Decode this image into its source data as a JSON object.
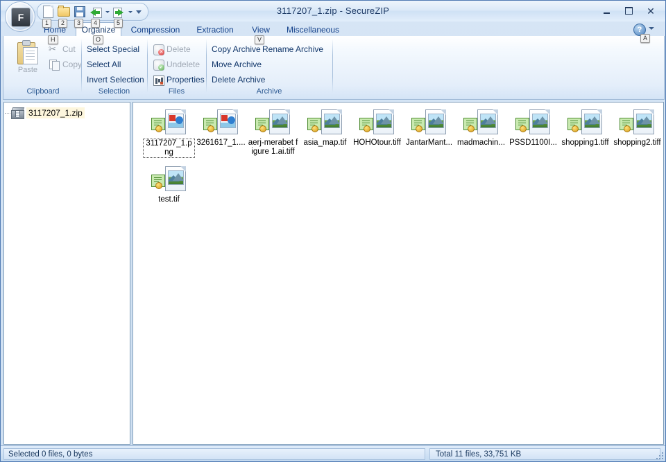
{
  "window": {
    "title": "3117207_1.zip - SecureZIP",
    "minimize_label": "Minimize",
    "maximize_label": "Maximize",
    "close_label": "Close"
  },
  "app_button": {
    "label": "F"
  },
  "quick_access": {
    "items": [
      {
        "name": "new-archive",
        "icon": "new-document-icon",
        "keytip": "1"
      },
      {
        "name": "open-archive",
        "icon": "open-folder-icon",
        "keytip": "2"
      },
      {
        "name": "save-archive",
        "icon": "save-icon",
        "keytip": "3"
      },
      {
        "name": "extract-files",
        "icon": "extract-arrow-icon",
        "keytip": "4"
      },
      {
        "name": "add-files",
        "icon": "add-arrow-icon",
        "keytip": "5"
      }
    ],
    "customize_label": "Customize Quick Access Toolbar"
  },
  "tabs": [
    {
      "label": "Home",
      "keytip": "H",
      "active": false
    },
    {
      "label": "Organize",
      "keytip": "O",
      "active": true
    },
    {
      "label": "Compression",
      "keytip": "",
      "active": false
    },
    {
      "label": "Extraction",
      "keytip": "",
      "active": false
    },
    {
      "label": "View",
      "keytip": "V",
      "active": false
    },
    {
      "label": "Miscellaneous",
      "keytip": "",
      "active": false
    }
  ],
  "help": {
    "glyph": "?",
    "keytip": "A"
  },
  "ribbon": {
    "groups": [
      {
        "name": "clipboard",
        "label": "Clipboard",
        "big_button": {
          "label": "Paste",
          "enabled": false
        },
        "commands": [
          {
            "label": "Cut",
            "enabled": false,
            "icon": "scissors-icon"
          },
          {
            "label": "Copy",
            "enabled": false,
            "icon": "copy-icon"
          }
        ]
      },
      {
        "name": "selection",
        "label": "Selection",
        "commands": [
          {
            "label": "Select Special",
            "enabled": true,
            "icon": ""
          },
          {
            "label": "Select All",
            "enabled": true,
            "icon": ""
          },
          {
            "label": "Invert Selection",
            "enabled": true,
            "icon": ""
          }
        ]
      },
      {
        "name": "files",
        "label": "Files",
        "commands": [
          {
            "label": "Delete",
            "enabled": false,
            "icon": "delete-icon"
          },
          {
            "label": "Undelete",
            "enabled": false,
            "icon": "undelete-icon"
          },
          {
            "label": "Properties",
            "enabled": true,
            "icon": "properties-icon"
          }
        ]
      },
      {
        "name": "archive",
        "label": "Archive",
        "commands": [
          {
            "label": "Copy Archive",
            "enabled": true,
            "icon": ""
          },
          {
            "label": "Rename Archive",
            "enabled": true,
            "icon": ""
          },
          {
            "label": "Move Archive",
            "enabled": true,
            "icon": ""
          },
          {
            "label": "Delete Archive",
            "enabled": true,
            "icon": ""
          }
        ]
      }
    ]
  },
  "tree": {
    "root": {
      "label": "3117207_1.zip",
      "icon": "archive-package-icon",
      "selected": true
    }
  },
  "files": [
    {
      "label": "3117207_1.png",
      "kind": "png",
      "focused": true
    },
    {
      "label": "3261617_1....",
      "kind": "png",
      "focused": false
    },
    {
      "label": "aerj-merabet figure 1.ai.tiff",
      "kind": "tiff",
      "focused": false
    },
    {
      "label": "asia_map.tif",
      "kind": "tiff",
      "focused": false
    },
    {
      "label": "HOHOtour.tiff",
      "kind": "tiff",
      "focused": false
    },
    {
      "label": "JantarMant...",
      "kind": "tiff",
      "focused": false
    },
    {
      "label": "madmachin...",
      "kind": "tiff",
      "focused": false
    },
    {
      "label": "PSSD1100I...",
      "kind": "tiff",
      "focused": false
    },
    {
      "label": "shopping1.tiff",
      "kind": "tiff",
      "focused": false
    },
    {
      "label": "shopping2.tiff",
      "kind": "tiff",
      "focused": false
    },
    {
      "label": "test.tif",
      "kind": "tiff",
      "focused": false
    }
  ],
  "status": {
    "left": "Selected 0 files, 0 bytes",
    "right": "Total 11 files, 33,751 KB"
  },
  "colors": {
    "accent": "#15428b",
    "chrome": "#cfe0f2",
    "panel": "#ffffff",
    "disabled_text": "#9fa8b4"
  }
}
